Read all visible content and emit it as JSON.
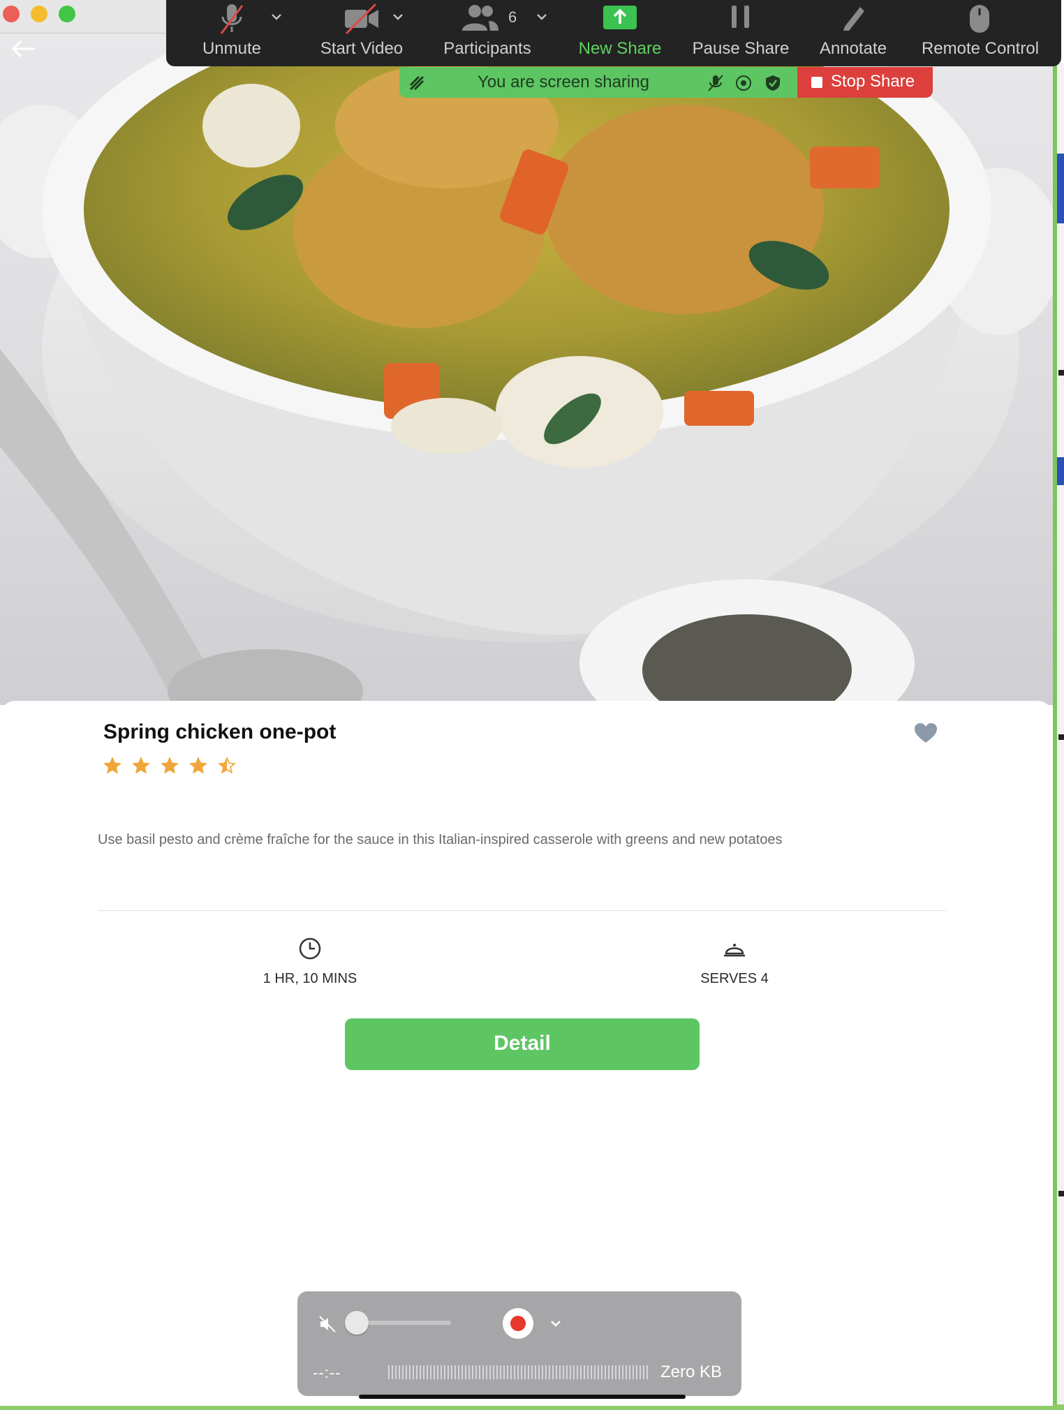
{
  "toolbar": {
    "unmute_label": "Unmute",
    "start_video_label": "Start Video",
    "participants_label": "Participants",
    "participants_count": "6",
    "new_share_label": "New Share",
    "pause_share_label": "Pause Share",
    "annotate_label": "Annotate",
    "remote_control_label": "Remote Control"
  },
  "share_banner": {
    "text": "You are screen sharing",
    "stop_label": "Stop Share"
  },
  "recipe": {
    "title": "Spring chicken one-pot",
    "rating": 4.5,
    "rating_max": 5,
    "description": "Use basil pesto and crème fraîche for the sauce in this Italian-inspired casserole with greens and new potatoes",
    "time": "1 HR, 10 MINS",
    "serves": "SERVES 4",
    "detail_button": "Detail"
  },
  "recorder": {
    "time": "--:--",
    "size": "Zero KB"
  },
  "colors": {
    "accent_green": "#5ec563",
    "stop_red": "#dc3f3c",
    "star": "#f0a63a",
    "toolbar_bg": "#232323"
  }
}
